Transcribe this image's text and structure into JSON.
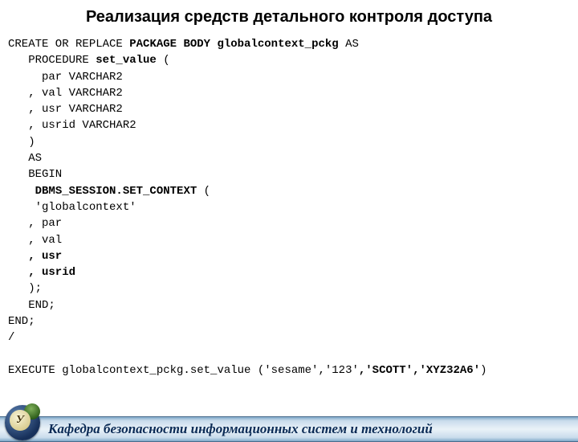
{
  "title": "Реализация средств детального контроля доступа",
  "footer": "Кафедра безопасности информационных систем и технологий",
  "logo_letter": "У",
  "code_lines": [
    [
      {
        "t": "CREATE OR REPLACE ",
        "b": false
      },
      {
        "t": "PACKAGE BODY globalcontext_pckg",
        "b": true
      },
      {
        "t": " AS",
        "b": false
      }
    ],
    [
      {
        "t": "   PROCEDURE ",
        "b": false
      },
      {
        "t": "set_value",
        "b": true
      },
      {
        "t": " (",
        "b": false
      }
    ],
    [
      {
        "t": "     par VARCHAR2",
        "b": false
      }
    ],
    [
      {
        "t": "   , val VARCHAR2",
        "b": false
      }
    ],
    [
      {
        "t": "   , usr VARCHAR2",
        "b": false
      }
    ],
    [
      {
        "t": "   , usrid VARCHAR2",
        "b": false
      }
    ],
    [
      {
        "t": "   )",
        "b": false
      }
    ],
    [
      {
        "t": "   AS",
        "b": false
      }
    ],
    [
      {
        "t": "   BEGIN",
        "b": false
      }
    ],
    [
      {
        "t": "    ",
        "b": false
      },
      {
        "t": "DBMS_SESSION.SET_CONTEXT",
        "b": true
      },
      {
        "t": " (",
        "b": false
      }
    ],
    [
      {
        "t": "    'globalcontext'",
        "b": false
      }
    ],
    [
      {
        "t": "   , par",
        "b": false
      }
    ],
    [
      {
        "t": "   , val",
        "b": false
      }
    ],
    [
      {
        "t": "   , usr",
        "b": true
      }
    ],
    [
      {
        "t": "   , usrid",
        "b": true
      }
    ],
    [
      {
        "t": "   );",
        "b": false
      }
    ],
    [
      {
        "t": "   END;",
        "b": false
      }
    ],
    [
      {
        "t": "END;",
        "b": false
      }
    ],
    [
      {
        "t": "/",
        "b": false
      }
    ],
    [
      {
        "t": "",
        "b": false
      }
    ],
    [
      {
        "t": "EXECUTE globalcontext_pckg.set_value ('sesame','123'",
        "b": false
      },
      {
        "t": ",'SCOTT','XYZ32A6'",
        "b": true
      },
      {
        "t": ")",
        "b": false
      }
    ]
  ]
}
